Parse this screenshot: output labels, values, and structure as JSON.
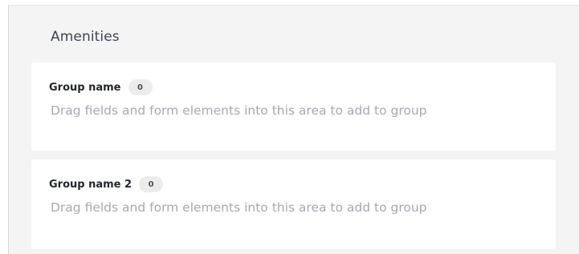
{
  "section": {
    "title": "Amenities"
  },
  "groups": [
    {
      "name": "Group name",
      "count": "0",
      "hint": "Drag fields and form elements into this area to add to group"
    },
    {
      "name": "Group name 2",
      "count": "0",
      "hint": "Drag fields and form elements into this area to add to group"
    }
  ],
  "colors": {
    "panel_background": "#f4f4f4",
    "card_background": "#ffffff",
    "title_text": "#3e4452",
    "group_name_text": "#22262e",
    "hint_text": "#a6a9b0",
    "count_badge": "#ececec"
  }
}
